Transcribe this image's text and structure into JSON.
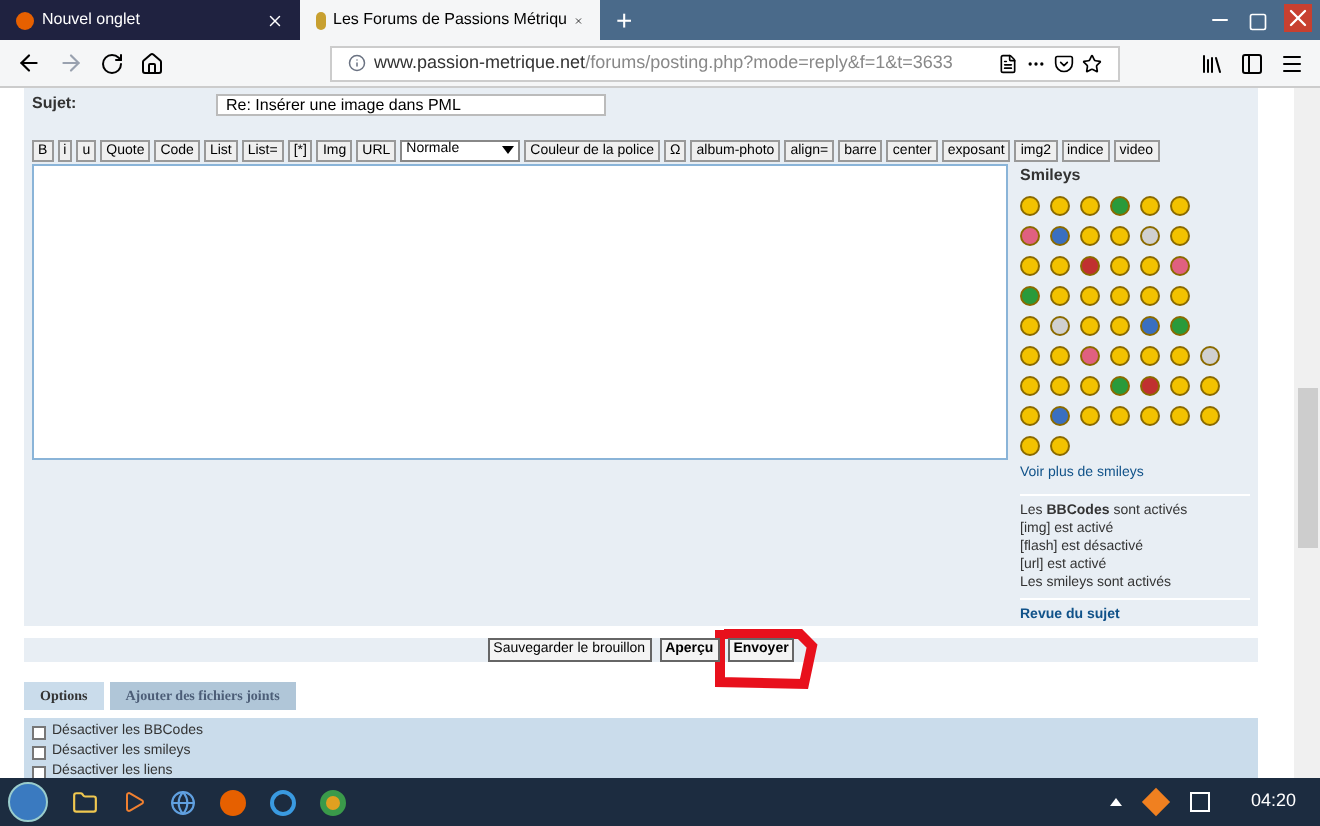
{
  "browser": {
    "tabs": [
      {
        "title": "Nouvel onglet",
        "selected": false
      },
      {
        "title": "Les Forums de Passions Métriqu",
        "selected": true
      }
    ],
    "new_tab": "+",
    "url_domain": "www.passion-metrique.net",
    "url_path": "/forums/posting.php?mode=reply&f=1&t=3633"
  },
  "form": {
    "subject_label": "Sujet:",
    "subject_value": "Re: Insérer une image dans PML",
    "toolbar": [
      {
        "kind": "button",
        "label": "B"
      },
      {
        "kind": "button",
        "label": "i"
      },
      {
        "kind": "button",
        "label": "u"
      },
      {
        "kind": "button",
        "label": "Quote"
      },
      {
        "kind": "button",
        "label": "Code"
      },
      {
        "kind": "button",
        "label": "List"
      },
      {
        "kind": "button",
        "label": "List="
      },
      {
        "kind": "button",
        "label": "[*]"
      },
      {
        "kind": "button",
        "label": "Img"
      },
      {
        "kind": "button",
        "label": "URL"
      },
      {
        "kind": "select",
        "label": "Normale"
      },
      {
        "kind": "button",
        "label": "Couleur de la police"
      },
      {
        "kind": "button",
        "label": "Ω"
      },
      {
        "kind": "button",
        "label": "album-photo"
      },
      {
        "kind": "button",
        "label": "align="
      },
      {
        "kind": "button",
        "label": "barre"
      },
      {
        "kind": "button",
        "label": "center"
      },
      {
        "kind": "button",
        "label": "exposant"
      },
      {
        "kind": "button",
        "label": "img2"
      },
      {
        "kind": "button",
        "label": "indice"
      },
      {
        "kind": "button",
        "label": "video"
      }
    ],
    "smileys_title": "Smileys",
    "more_smileys": "Voir plus de smileys",
    "status_lines": [
      "Les **BBCodes** sont activés",
      "[img] est activé",
      "[flash] est désactivé",
      "[url] est activé",
      "Les smileys sont activés"
    ],
    "review_link": "Revue du sujet",
    "buttons": [
      "Sauvegarder le brouillon",
      "Aperçu",
      "Envoyer"
    ],
    "option_tabs": [
      {
        "label": "Options",
        "selected": true
      },
      {
        "label": "Ajouter des fichiers joints",
        "selected": false
      }
    ],
    "options": [
      {
        "label": "Désactiver les BBCodes",
        "checked": false
      },
      {
        "label": "Désactiver les smileys",
        "checked": false
      },
      {
        "label": "Désactiver les liens",
        "checked": false
      }
    ]
  },
  "taskbar": {
    "clock": "04:20"
  }
}
